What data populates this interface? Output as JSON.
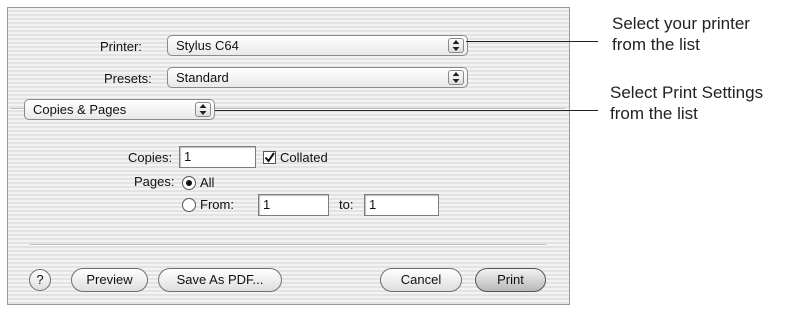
{
  "printer": {
    "label": "Printer:",
    "value": "Stylus C64"
  },
  "presets": {
    "label": "Presets:",
    "value": "Standard"
  },
  "panel_popup": {
    "value": "Copies & Pages"
  },
  "copies": {
    "label": "Copies:",
    "value": "1",
    "collated_label": "Collated",
    "collated_checked": true
  },
  "pages": {
    "label": "Pages:",
    "all_label": "All",
    "from_label": "From:",
    "from_value": "1",
    "to_label": "to:",
    "to_value": "1",
    "selected": "All"
  },
  "buttons": {
    "help": "?",
    "preview": "Preview",
    "save_as_pdf": "Save As PDF...",
    "cancel": "Cancel",
    "print": "Print"
  },
  "callouts": {
    "printer_line1": "Select your printer",
    "printer_line2": "from the list",
    "settings_line1": "Select Print Settings",
    "settings_line2": "from the list"
  },
  "icons": {
    "popup_arrows": "up-down-arrows-icon",
    "checkbox": "checkmark-icon",
    "radio": "radio-dot-icon",
    "help": "help-icon"
  }
}
